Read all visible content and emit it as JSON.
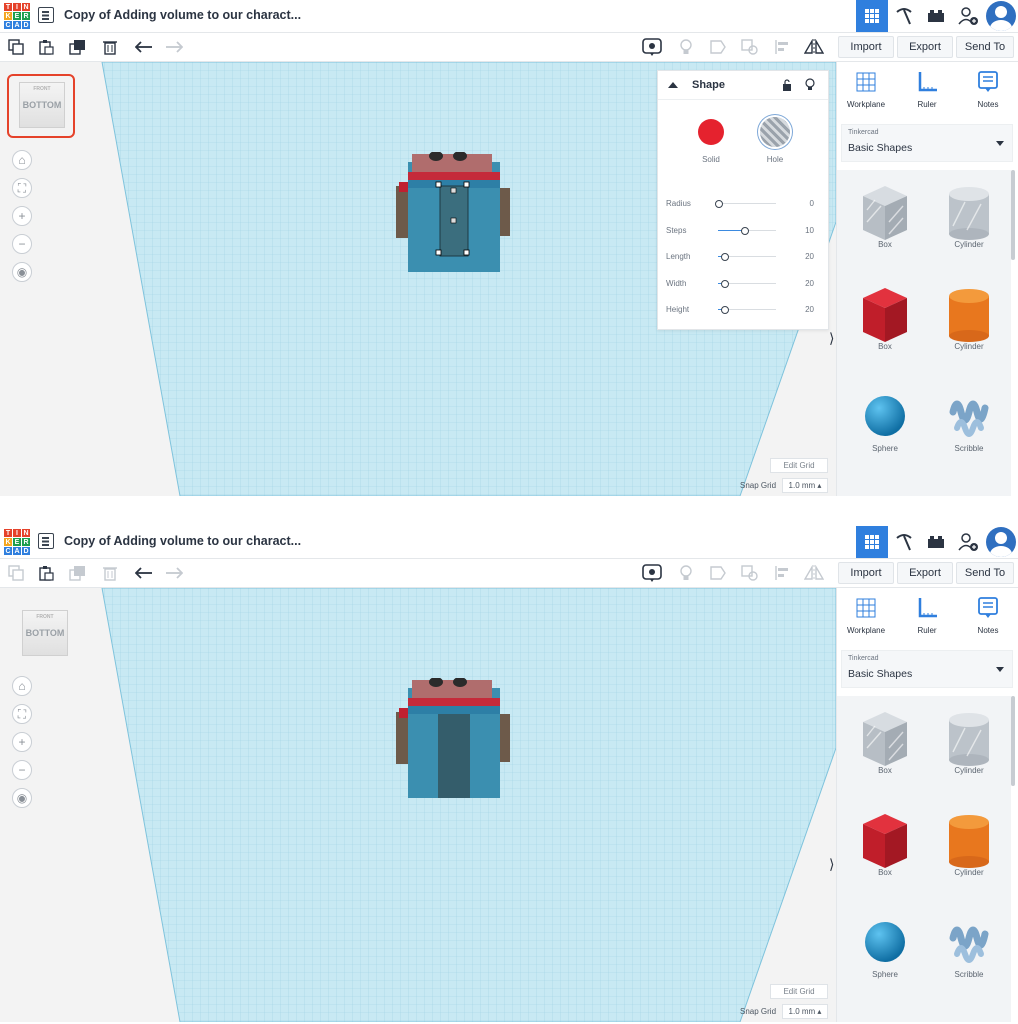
{
  "screens": [
    {
      "app": {
        "logo_letters": [
          "T",
          "I",
          "N",
          "K",
          "E",
          "R",
          "C",
          "A",
          "D"
        ],
        "title": "Copy of Adding volume to our charact..."
      },
      "toolbar": {
        "import": "Import",
        "export": "Export",
        "send_to": "Send To"
      },
      "view_cube": {
        "face": "BOTTOM",
        "top_text": "FRONT",
        "highlighted": true
      },
      "inspector": {
        "title": "Shape",
        "solid_label": "Solid",
        "hole_label": "Hole",
        "properties": [
          {
            "label": "Radius",
            "value": "0",
            "fraction": 0.0
          },
          {
            "label": "Steps",
            "value": "10",
            "fraction": 0.45
          },
          {
            "label": "Length",
            "value": "20",
            "fraction": 0.1
          },
          {
            "label": "Width",
            "value": "20",
            "fraction": 0.1
          },
          {
            "label": "Height",
            "value": "20",
            "fraction": 0.1
          }
        ]
      },
      "edit_grid": "Edit Grid",
      "snap_grid_label": "Snap Grid",
      "snap_grid_value": "1.0 mm",
      "sidebar": {
        "workplane": "Workplane",
        "ruler": "Ruler",
        "notes": "Notes",
        "library_small": "Tinkercad",
        "library": "Basic Shapes",
        "shapes": [
          "Box",
          "Cylinder",
          "Box",
          "Cylinder",
          "Sphere",
          "Scribble"
        ]
      },
      "selected_hole": true
    },
    {
      "app": {
        "logo_letters": [
          "T",
          "I",
          "N",
          "K",
          "E",
          "R",
          "C",
          "A",
          "D"
        ],
        "title": "Copy of Adding volume to our charact..."
      },
      "toolbar": {
        "import": "Import",
        "export": "Export",
        "send_to": "Send To"
      },
      "view_cube": {
        "face": "BOTTOM",
        "top_text": "FRONT",
        "highlighted": false
      },
      "edit_grid": "Edit Grid",
      "snap_grid_label": "Snap Grid",
      "snap_grid_value": "1.0 mm",
      "sidebar": {
        "workplane": "Workplane",
        "ruler": "Ruler",
        "notes": "Notes",
        "library_small": "Tinkercad",
        "library": "Basic Shapes",
        "shapes": [
          "Box",
          "Cylinder",
          "Box",
          "Cylinder",
          "Sphere",
          "Scribble"
        ]
      },
      "selected_hole": false
    }
  ],
  "colors": {
    "accent": "#2f7fde",
    "grid": "#bfe3ef",
    "solid_red": "#e5222e",
    "cube_highlight": "#e5422a"
  }
}
